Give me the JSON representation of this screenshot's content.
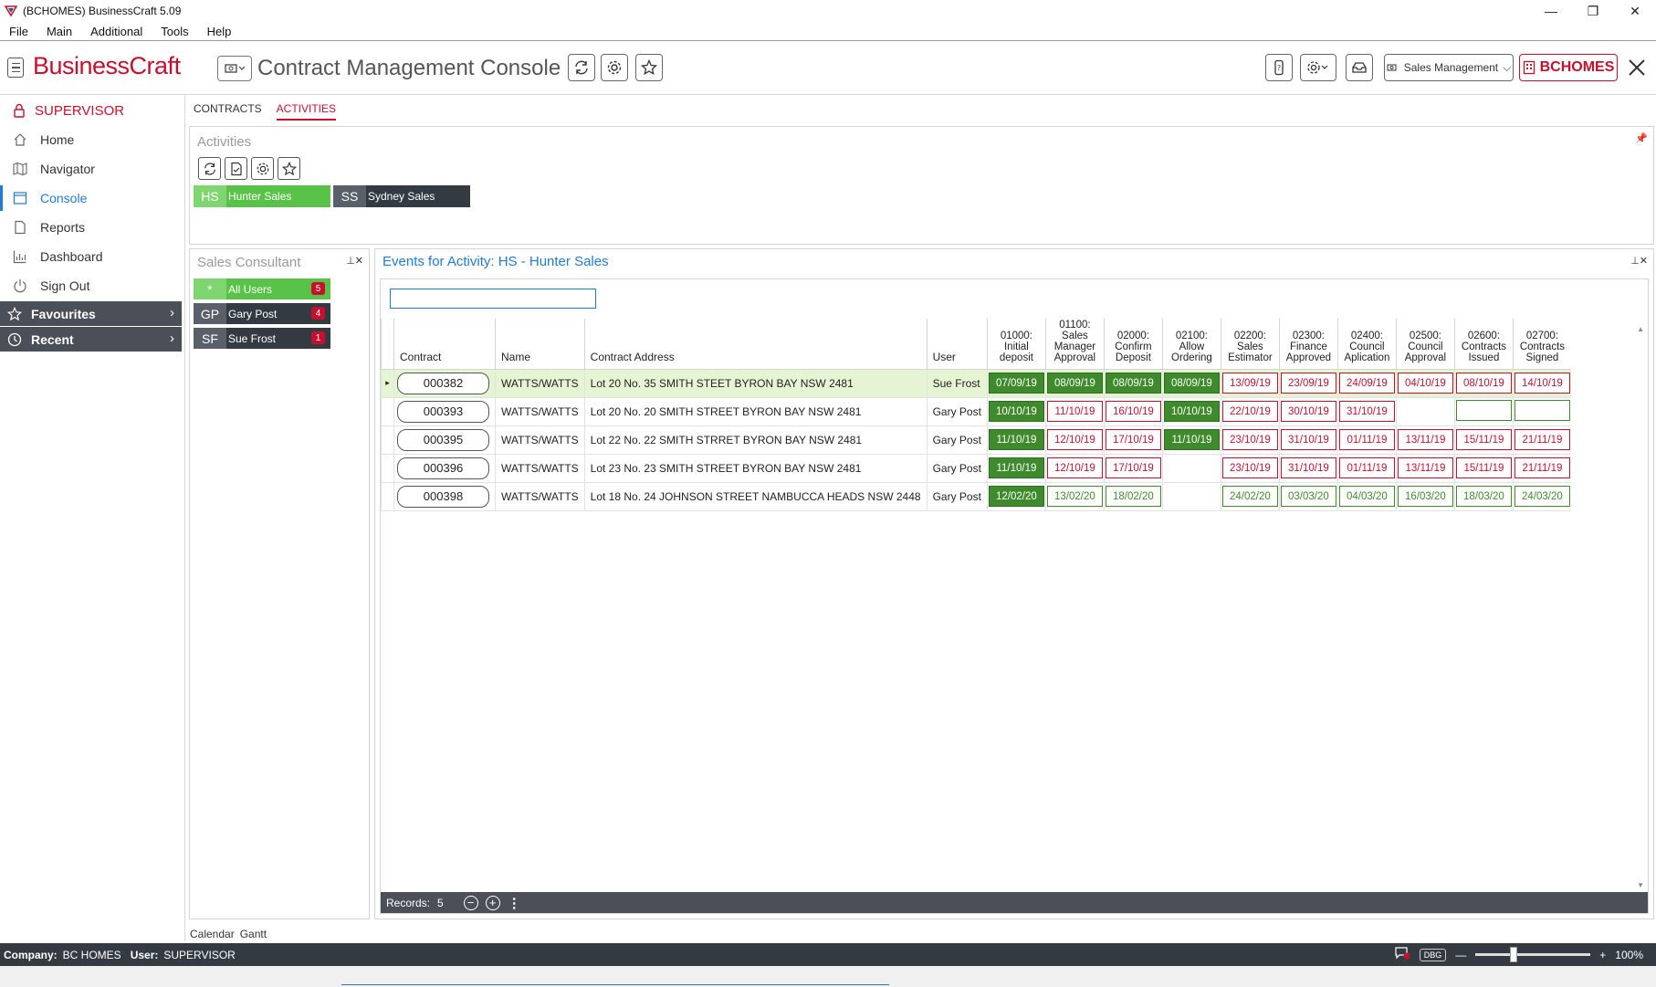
{
  "window": {
    "title": "(BCHOMES) BusinessCraft  5.09",
    "minimize": "—",
    "restore": "❐",
    "close": "✕"
  },
  "menu": [
    "File",
    "Main",
    "Additional",
    "Tools",
    "Help"
  ],
  "header": {
    "logo": "BusinessCraft",
    "console_title": "Contract Management Console",
    "module": "Sales Management",
    "company": "BCHOMES"
  },
  "nav": {
    "user": "SUPERVISOR",
    "items": [
      {
        "label": "Home",
        "icon": "home-icon"
      },
      {
        "label": "Navigator",
        "icon": "map-icon"
      },
      {
        "label": "Console",
        "icon": "console-icon",
        "active": true
      },
      {
        "label": "Reports",
        "icon": "document-icon"
      },
      {
        "label": "Dashboard",
        "icon": "bar-chart-icon"
      },
      {
        "label": "Sign Out",
        "icon": "power-icon"
      }
    ],
    "favourites": "Favourites",
    "recent": "Recent"
  },
  "tabs": [
    "CONTRACTS",
    "ACTIVITIES"
  ],
  "activities": {
    "title": "Activities",
    "tiles": [
      {
        "abbr": "HS",
        "label": "Hunter Sales",
        "color": "#59c349",
        "abbr_color": "#7fd670"
      },
      {
        "abbr": "SS",
        "label": "Sydney Sales",
        "color": "#343a42",
        "abbr_color": "#5a6069"
      }
    ]
  },
  "consultant": {
    "title": "Sales Consultant",
    "tiles": [
      {
        "abbr": "*",
        "label": "All Users",
        "count": "5",
        "color": "#59c349",
        "abbr_color": "#7fd670"
      },
      {
        "abbr": "GP",
        "label": "Gary Post",
        "count": "4",
        "color": "#343a42",
        "abbr_color": "#5a6069"
      },
      {
        "abbr": "SF",
        "label": "Sue Frost",
        "count": "1",
        "color": "#343a42",
        "abbr_color": "#5a6069"
      }
    ]
  },
  "events": {
    "title": "Events for Activity: HS - Hunter Sales",
    "filter_value": "",
    "columns": [
      "Contract",
      "Name",
      "Contract Address",
      "User"
    ],
    "event_columns": [
      [
        "01000:",
        "Initial",
        "deposit"
      ],
      [
        "01100:",
        "Sales",
        "Manager",
        "Approval"
      ],
      [
        "02000:",
        "Confirm",
        "Deposit"
      ],
      [
        "02100:",
        "Allow",
        "Ordering"
      ],
      [
        "02200:",
        "Sales",
        "Estimator"
      ],
      [
        "02300:",
        "Finance",
        "Approved"
      ],
      [
        "02400:",
        "Council",
        "Aplication"
      ],
      [
        "02500:",
        "Council",
        "Approval"
      ],
      [
        "02600:",
        "Contracts",
        "Issued"
      ],
      [
        "02700:",
        "Contracts",
        "Signed"
      ]
    ],
    "rows": [
      {
        "contract": "000382",
        "name": "WATTS/WATTS",
        "address": "Lot 20 No. 35 SMITH STEET BYRON BAY NSW 2481",
        "user": "Sue Frost",
        "selected": true,
        "events": [
          [
            "07/09/19",
            "done"
          ],
          [
            "08/09/19",
            "done"
          ],
          [
            "08/09/19",
            "done"
          ],
          [
            "08/09/19",
            "done"
          ],
          [
            "13/09/19",
            "late"
          ],
          [
            "23/09/19",
            "late"
          ],
          [
            "24/09/19",
            "late"
          ],
          [
            "04/10/19",
            "late"
          ],
          [
            "08/10/19",
            "late"
          ],
          [
            "14/10/19",
            "late"
          ]
        ]
      },
      {
        "contract": "000393",
        "name": "WATTS/WATTS",
        "address": "Lot 20 No. 20 SMITH STREET BYRON BAY NSW 2481",
        "user": "Gary Post",
        "events": [
          [
            "10/10/19",
            "done"
          ],
          [
            "11/10/19",
            "late"
          ],
          [
            "16/10/19",
            "late"
          ],
          [
            "10/10/19",
            "done"
          ],
          [
            "22/10/19",
            "late"
          ],
          [
            "30/10/19",
            "late"
          ],
          [
            "31/10/19",
            "late"
          ],
          [
            "",
            "empty"
          ],
          [
            "",
            "emptyg"
          ],
          [
            "",
            "emptyg"
          ]
        ]
      },
      {
        "contract": "000395",
        "name": "WATTS/WATTS",
        "address": "Lot 22 No. 22 SMITH STRRET BYRON BAY NSW 2481",
        "user": "Gary Post",
        "events": [
          [
            "11/10/19",
            "done"
          ],
          [
            "12/10/19",
            "late"
          ],
          [
            "17/10/19",
            "late"
          ],
          [
            "11/10/19",
            "done"
          ],
          [
            "23/10/19",
            "late"
          ],
          [
            "31/10/19",
            "late"
          ],
          [
            "01/11/19",
            "late"
          ],
          [
            "13/11/19",
            "late"
          ],
          [
            "15/11/19",
            "late"
          ],
          [
            "21/11/19",
            "late"
          ]
        ]
      },
      {
        "contract": "000396",
        "name": "WATTS/WATTS",
        "address": "Lot 23 No. 23 SMITH STREET BYRON BAY NSW 2481",
        "user": "Gary Post",
        "events": [
          [
            "11/10/19",
            "done"
          ],
          [
            "12/10/19",
            "late"
          ],
          [
            "17/10/19",
            "late"
          ],
          [
            "",
            "empty"
          ],
          [
            "23/10/19",
            "late"
          ],
          [
            "31/10/19",
            "late"
          ],
          [
            "01/11/19",
            "late"
          ],
          [
            "13/11/19",
            "late"
          ],
          [
            "15/11/19",
            "late"
          ],
          [
            "21/11/19",
            "late"
          ]
        ]
      },
      {
        "contract": "000398",
        "name": "WATTS/WATTS",
        "address": "Lot 18 No. 24 JOHNSON STREET NAMBUCCA HEADS NSW 2448",
        "user": "Gary Post",
        "events": [
          [
            "12/02/20",
            "done"
          ],
          [
            "13/02/20",
            "plan"
          ],
          [
            "18/02/20",
            "plan"
          ],
          [
            "",
            "empty"
          ],
          [
            "24/02/20",
            "plan"
          ],
          [
            "03/03/20",
            "plan"
          ],
          [
            "04/03/20",
            "plan"
          ],
          [
            "16/03/20",
            "plan"
          ],
          [
            "18/03/20",
            "plan"
          ],
          [
            "24/03/20",
            "plan"
          ]
        ]
      }
    ],
    "records_label": "Records:",
    "records_count": "5"
  },
  "footer_links": [
    "Calendar",
    "Gantt"
  ],
  "status": {
    "company_label": "Company:",
    "company": "BC HOMES",
    "user_label": "User:",
    "user": "SUPERVISOR",
    "dbg": "DBG",
    "zoom": "100%",
    "zoom_level": 0.33
  },
  "colors": {
    "brand_red": "#c8102e",
    "done_green": "#3f8a2c",
    "accent_blue": "#1f7bd6"
  }
}
